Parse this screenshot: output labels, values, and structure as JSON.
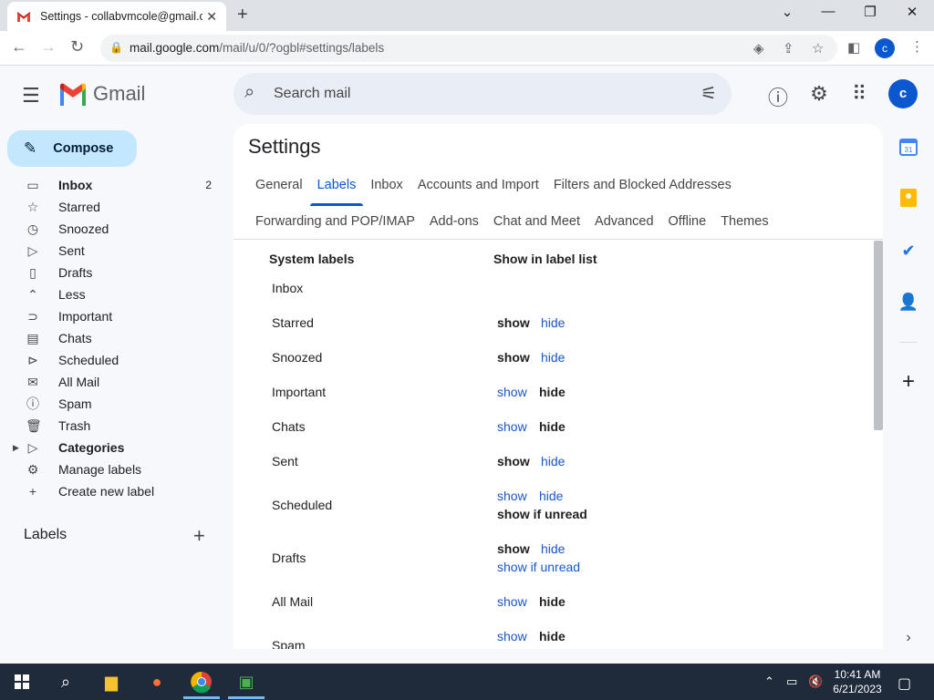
{
  "browser": {
    "tab_title": "Settings - collabvmcole@gmail.c",
    "url_host": "mail.google.com",
    "url_path": "/mail/u/0/?ogbl#settings/labels",
    "profile_initial": "c"
  },
  "gmail": {
    "logo_text": "Gmail",
    "search_placeholder": "Search mail",
    "avatar_initial": "c"
  },
  "compose_label": "Compose",
  "nav": {
    "items": [
      {
        "label": "Inbox",
        "count": "2"
      },
      {
        "label": "Starred"
      },
      {
        "label": "Snoozed"
      },
      {
        "label": "Sent"
      },
      {
        "label": "Drafts"
      },
      {
        "label": "Less"
      },
      {
        "label": "Important"
      },
      {
        "label": "Chats"
      },
      {
        "label": "Scheduled"
      },
      {
        "label": "All Mail"
      },
      {
        "label": "Spam"
      },
      {
        "label": "Trash"
      },
      {
        "label": "Categories"
      },
      {
        "label": "Manage labels"
      },
      {
        "label": "Create new label"
      }
    ],
    "labels_heading": "Labels"
  },
  "settings": {
    "title": "Settings",
    "tabs_row1": [
      "General",
      "Labels",
      "Inbox",
      "Accounts and Import",
      "Filters and Blocked Addresses"
    ],
    "tabs_row2": [
      "Forwarding and POP/IMAP",
      "Add-ons",
      "Chat and Meet",
      "Advanced",
      "Offline",
      "Themes"
    ],
    "active_tab": "Labels",
    "col_system": "System labels",
    "col_show": "Show in label list",
    "opt_show": "show",
    "opt_hide": "hide",
    "opt_unread": "show if unread",
    "rows": [
      {
        "label": "Inbox",
        "selected": ""
      },
      {
        "label": "Starred",
        "selected": "show"
      },
      {
        "label": "Snoozed",
        "selected": "show"
      },
      {
        "label": "Important",
        "selected": "hide"
      },
      {
        "label": "Chats",
        "selected": "hide"
      },
      {
        "label": "Sent",
        "selected": "show"
      },
      {
        "label": "Scheduled",
        "selected": "show if unread"
      },
      {
        "label": "Drafts",
        "selected": "show"
      },
      {
        "label": "All Mail",
        "selected": "hide"
      },
      {
        "label": "Spam",
        "selected": "hide"
      }
    ]
  },
  "taskbar": {
    "time": "10:41 AM",
    "date": "6/21/2023"
  },
  "colors": {
    "accent": "#0b57d0",
    "compose_bg": "#c2e7ff",
    "link": "#1a57c9"
  }
}
